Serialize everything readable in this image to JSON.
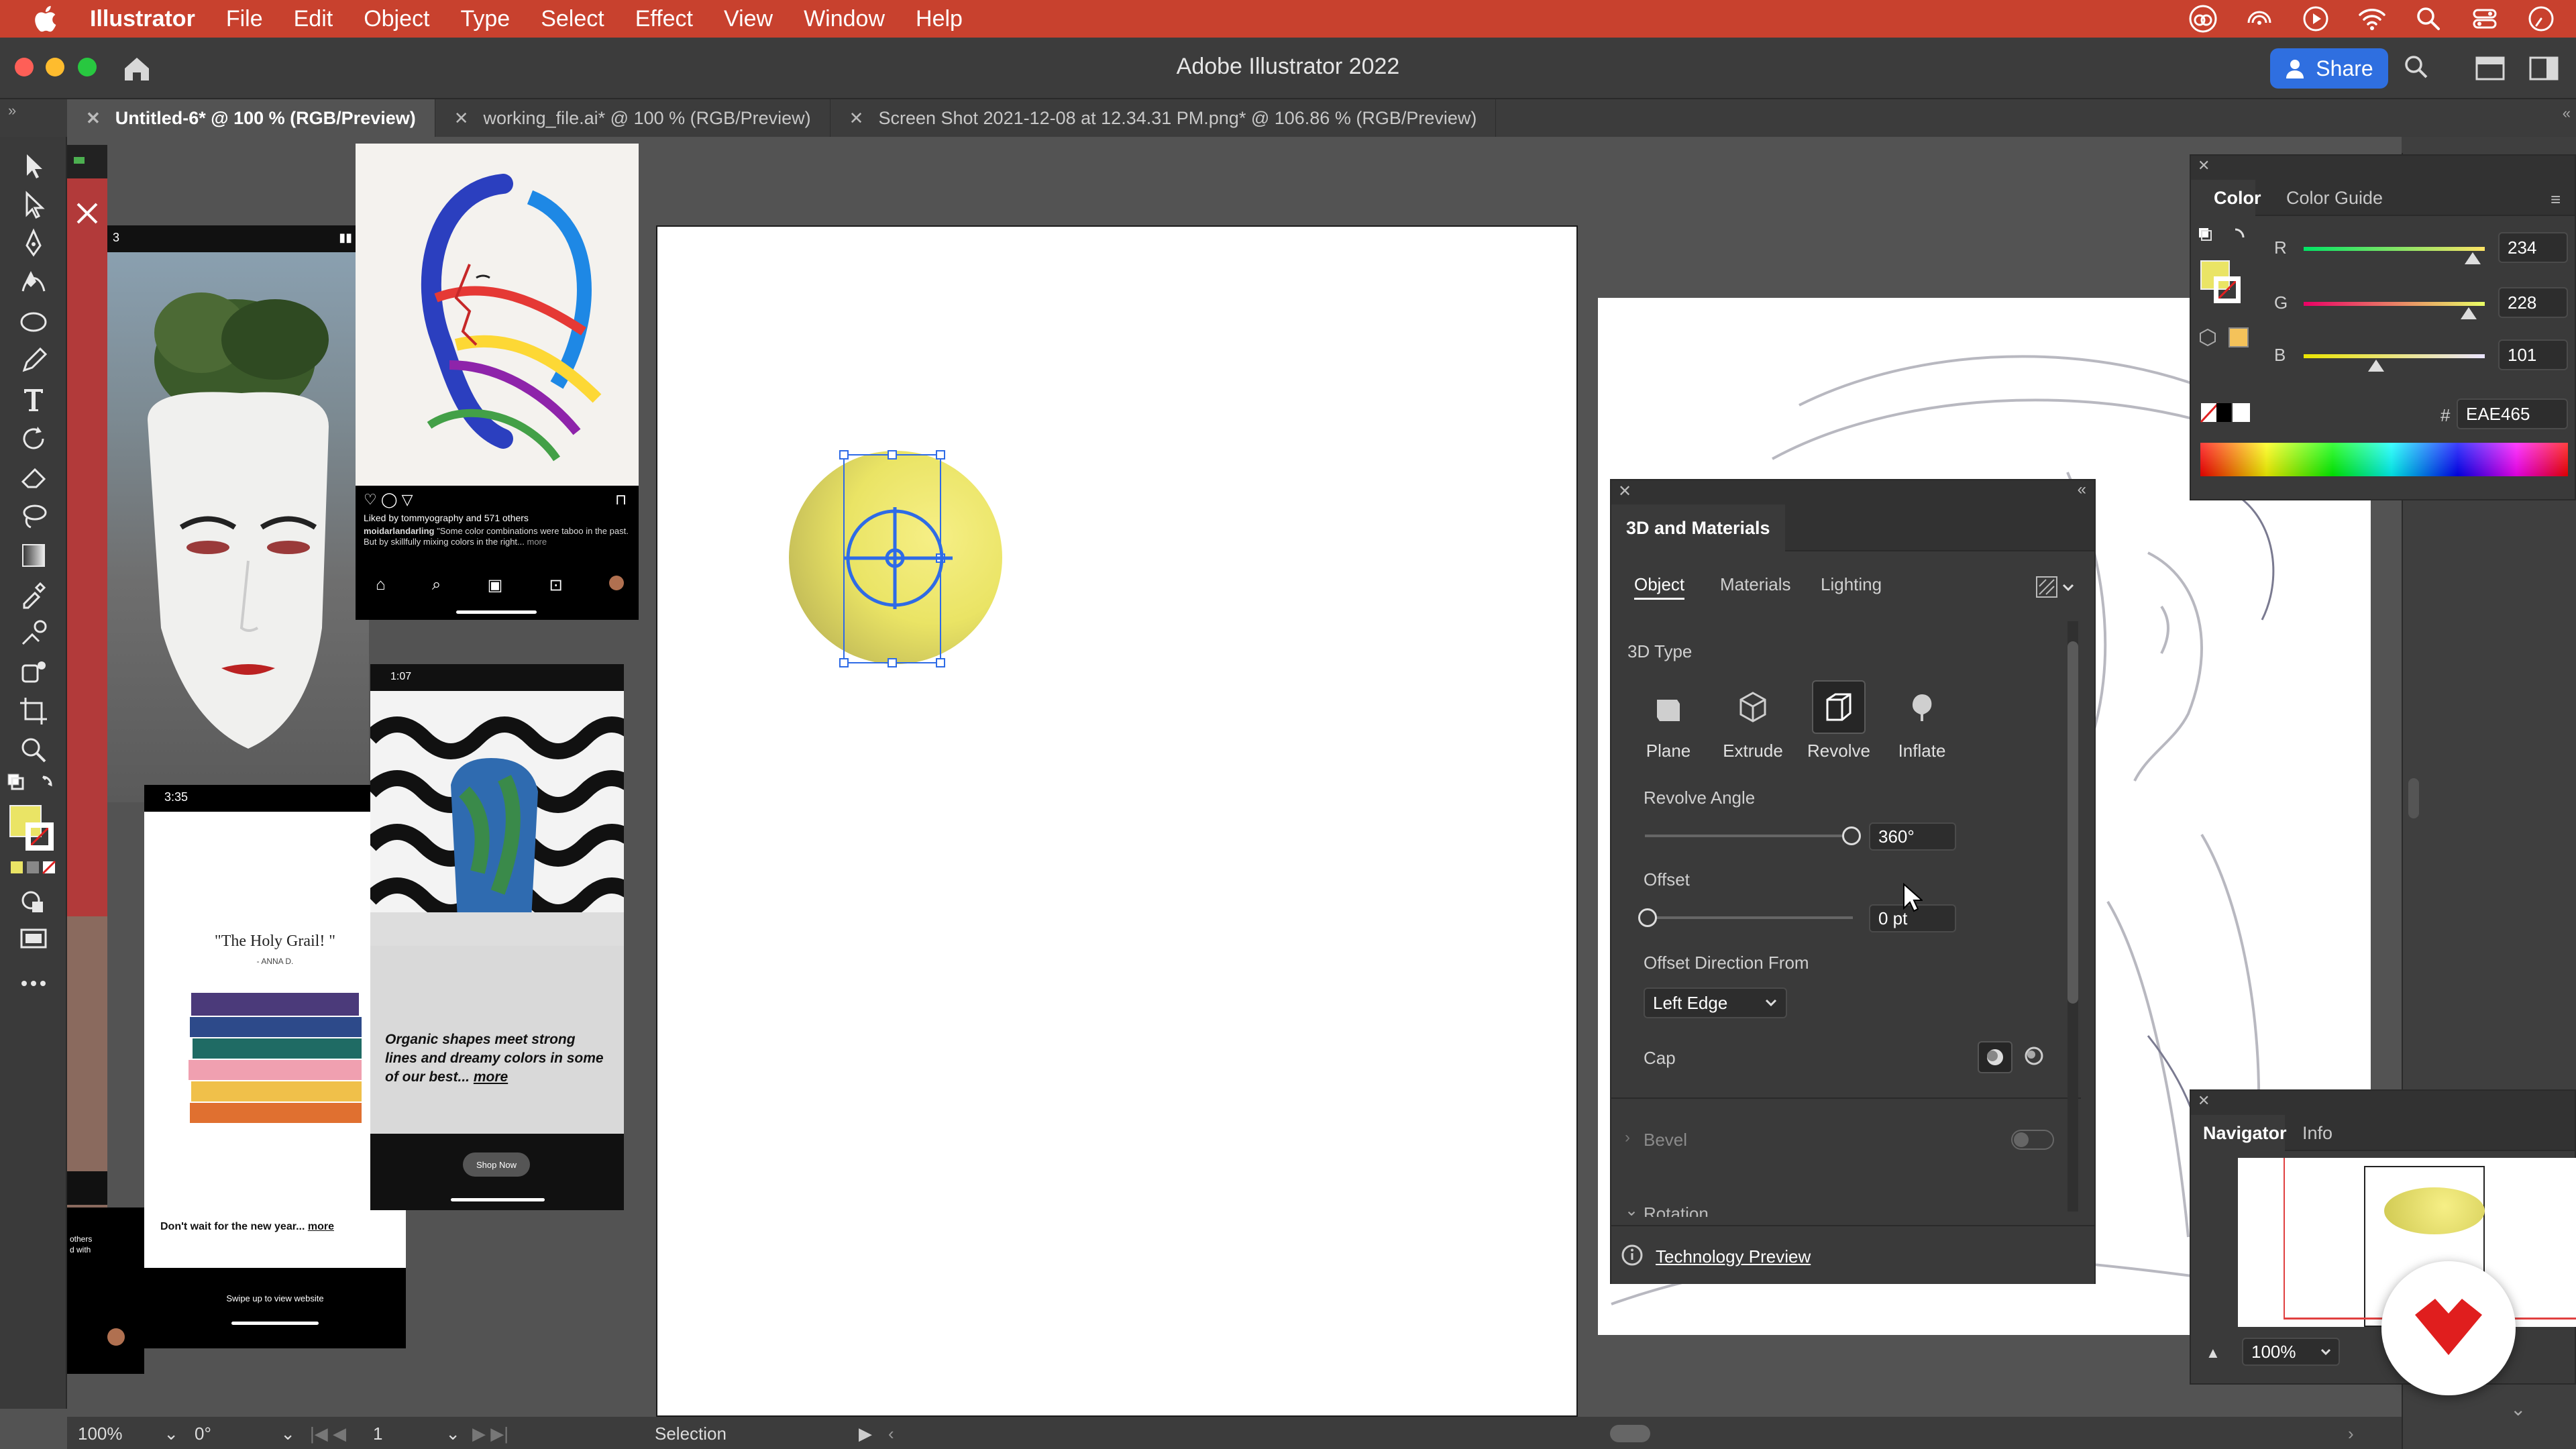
{
  "menubar": {
    "app": "Illustrator",
    "items": [
      "File",
      "Edit",
      "Object",
      "Type",
      "Select",
      "Effect",
      "View",
      "Window",
      "Help"
    ]
  },
  "window": {
    "title": "Adobe Illustrator 2022",
    "share_label": "Share"
  },
  "tabs": [
    {
      "label": "Untitled-6* @ 100 % (RGB/Preview)",
      "active": true
    },
    {
      "label": "working_file.ai* @ 100 % (RGB/Preview)",
      "active": false
    },
    {
      "label": "Screen Shot 2021-12-08 at 12.34.31 PM.png* @ 106.86 % (RGB/Preview)",
      "active": false
    }
  ],
  "moodboard": {
    "phone1_time": "3:35",
    "phone2_time": "1:07",
    "instagram_likes": "Liked by tommyography and 571 others",
    "instagram_caption_user": "moidarlandarling",
    "instagram_caption": "\"Some color combinations were taboo in the past. But by skillfully mixing colors in the right...",
    "instagram_caption_more": "more",
    "quote": "\"The Holy Grail! \"",
    "quote_author": "- ANNA D.",
    "promo_text": "Don't wait for the new year...",
    "promo_more": "more",
    "swipe_text": "Swipe up to view website",
    "organic_text": "Organic shapes meet strong lines and dreamy colors in some of our best...",
    "organic_more": "more",
    "shop_now": "Shop Now",
    "side_text_a": "others",
    "side_text_b": "d with"
  },
  "color_panel": {
    "tabs": [
      "Color",
      "Color Guide"
    ],
    "r": {
      "label": "R",
      "value": "234"
    },
    "g": {
      "label": "G",
      "value": "228"
    },
    "b": {
      "label": "B",
      "value": "101"
    },
    "hash": "#",
    "hex": "EAE465",
    "fill_color": "#EAE465"
  },
  "panel3d": {
    "title": "3D and Materials",
    "tabs": [
      "Object",
      "Materials",
      "Lighting"
    ],
    "section_3d_type": "3D Type",
    "types": [
      "Plane",
      "Extrude",
      "Revolve",
      "Inflate"
    ],
    "selected_type": "Revolve",
    "revolve_angle_label": "Revolve Angle",
    "revolve_angle_value": "360°",
    "offset_label": "Offset",
    "offset_value": "0 pt",
    "offset_dir_label": "Offset Direction From",
    "offset_dir_value": "Left Edge",
    "cap_label": "Cap",
    "bevel_label": "Bevel",
    "rotation_label": "Rotation",
    "tech_preview": "Technology Preview"
  },
  "navigator": {
    "tabs": [
      "Navigator",
      "Info"
    ],
    "zoom": "100%"
  },
  "statusbar": {
    "zoom": "100%",
    "rotation": "0°",
    "artboard": "1",
    "tool": "Selection"
  },
  "colors": {
    "menubar": "#C8412E",
    "ui_dark": "#3A3A3A",
    "canvas_bg": "#535353",
    "accent_blue": "#2F6FE0",
    "selection_blue": "#2E6BE6"
  }
}
